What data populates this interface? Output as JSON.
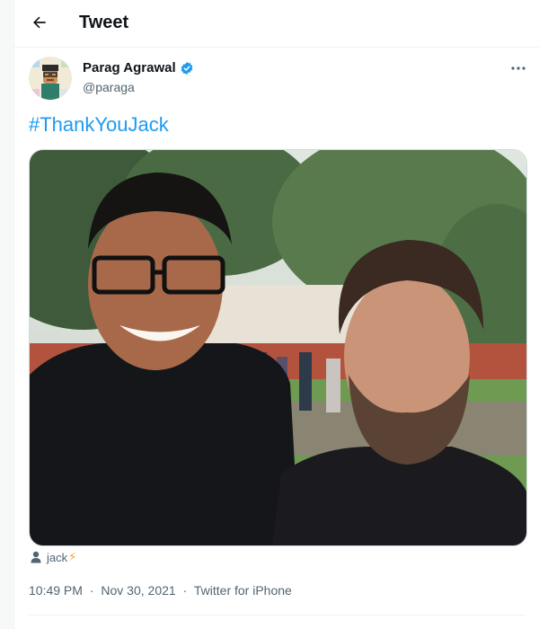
{
  "header": {
    "back_icon": "arrow-left-icon",
    "title": "Tweet"
  },
  "tweet": {
    "author": {
      "name": "Parag Agrawal",
      "handle": "@paraga",
      "verified": true,
      "verified_icon": "verified-badge-icon",
      "verified_color": "#1d9bf0"
    },
    "more_icon": "more-options-icon",
    "text": "#ThankYouJack",
    "text_color": "#1d9bf0",
    "media": {
      "type": "photo",
      "people_count": 2
    },
    "tagged_user": {
      "icon": "person-icon",
      "name": "jack",
      "emoji": "⚡"
    },
    "meta": {
      "time": "10:49 PM",
      "separator": "·",
      "date": "Nov 30, 2021",
      "source": "Twitter for iPhone"
    }
  }
}
